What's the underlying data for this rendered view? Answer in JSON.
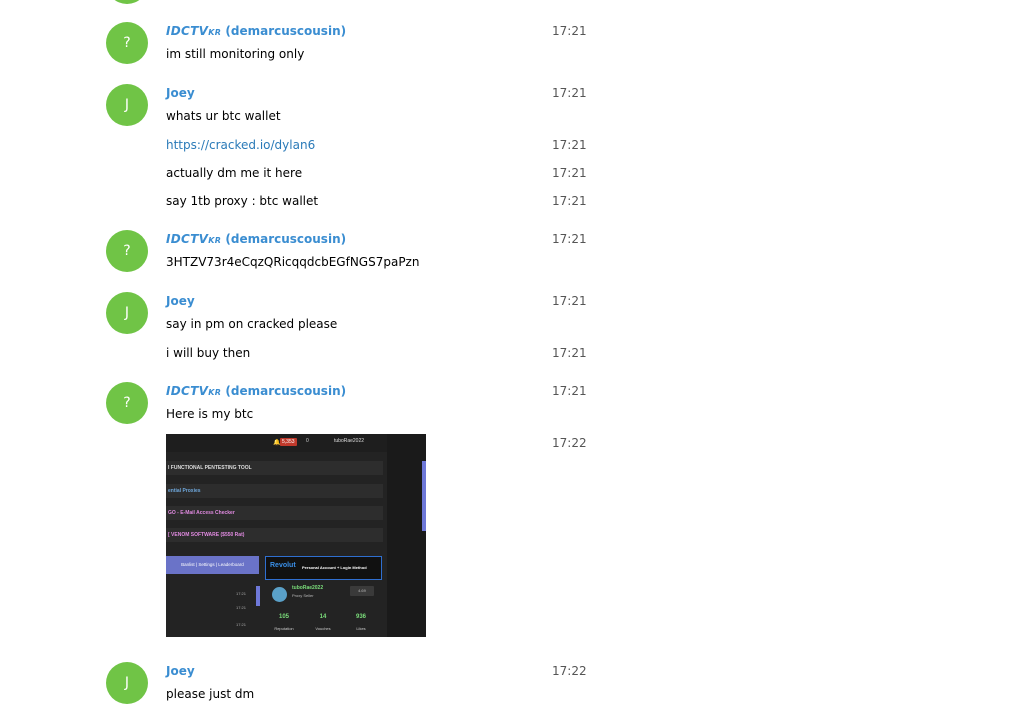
{
  "users": {
    "unknown": {
      "avatar_letter": "?",
      "alias": "IDCTV",
      "alias_sub": "KR",
      "handle": "(demarcuscousin)"
    },
    "joey": {
      "avatar_letter": "J",
      "name": "Joey"
    }
  },
  "messages": [
    {
      "author": "unknown",
      "text": "im still monitoring only",
      "time": "17:21"
    },
    {
      "author": "joey",
      "text": "whats ur btc wallet",
      "time": "17:21"
    },
    {
      "author": "joey",
      "text": "https://cracked.io/dylan6",
      "time": "17:21",
      "is_link": true
    },
    {
      "author": "joey",
      "text": "actually dm me it here",
      "time": "17:21"
    },
    {
      "author": "joey",
      "text": "say 1tb proxy : btc wallet",
      "time": "17:21"
    },
    {
      "author": "unknown",
      "text": "3HTZV73r4eCqzQRicqqdcbEGfNGS7paPzn",
      "time": "17:21"
    },
    {
      "author": "joey",
      "text": "say in pm on cracked please",
      "time": "17:21"
    },
    {
      "author": "joey",
      "text": "i will buy then",
      "time": "17:21"
    },
    {
      "author": "unknown",
      "text": "Here is my btc",
      "time": "17:21"
    },
    {
      "author": "unknown",
      "attachment": "screenshot",
      "time": "17:22"
    },
    {
      "author": "joey",
      "text": "please just dm",
      "time": "17:22"
    }
  ],
  "attachment": {
    "notification_count": "5,353",
    "inbox_count": "0",
    "top_username": "tuboRae2022",
    "rows": [
      "I FUNCTIONAL PENTESTING TOOL",
      "ential Proxies",
      "GO - E-Mail Access Checker",
      "[ VENOM SOFTWARE ($550 Rat)"
    ],
    "blue_button": "Banlist | Settings | Leaderboard",
    "revolut_brand": "Revolut",
    "revolut_desc": "Personal Account + Login Method",
    "ticks": [
      "17:21",
      "17:21",
      "17:21"
    ],
    "profile_name": "tuboRae2022",
    "profile_role": "Proxy Seller",
    "profile_badge": "4.69",
    "stats": [
      {
        "value": "105",
        "label": "Reputation"
      },
      {
        "value": "14",
        "label": "Vouches"
      },
      {
        "value": "936",
        "label": "Likes"
      }
    ]
  },
  "colors": {
    "avatar_bg": "#70c446",
    "author_name": "#3a8dd1",
    "link": "#2a7ab8"
  }
}
